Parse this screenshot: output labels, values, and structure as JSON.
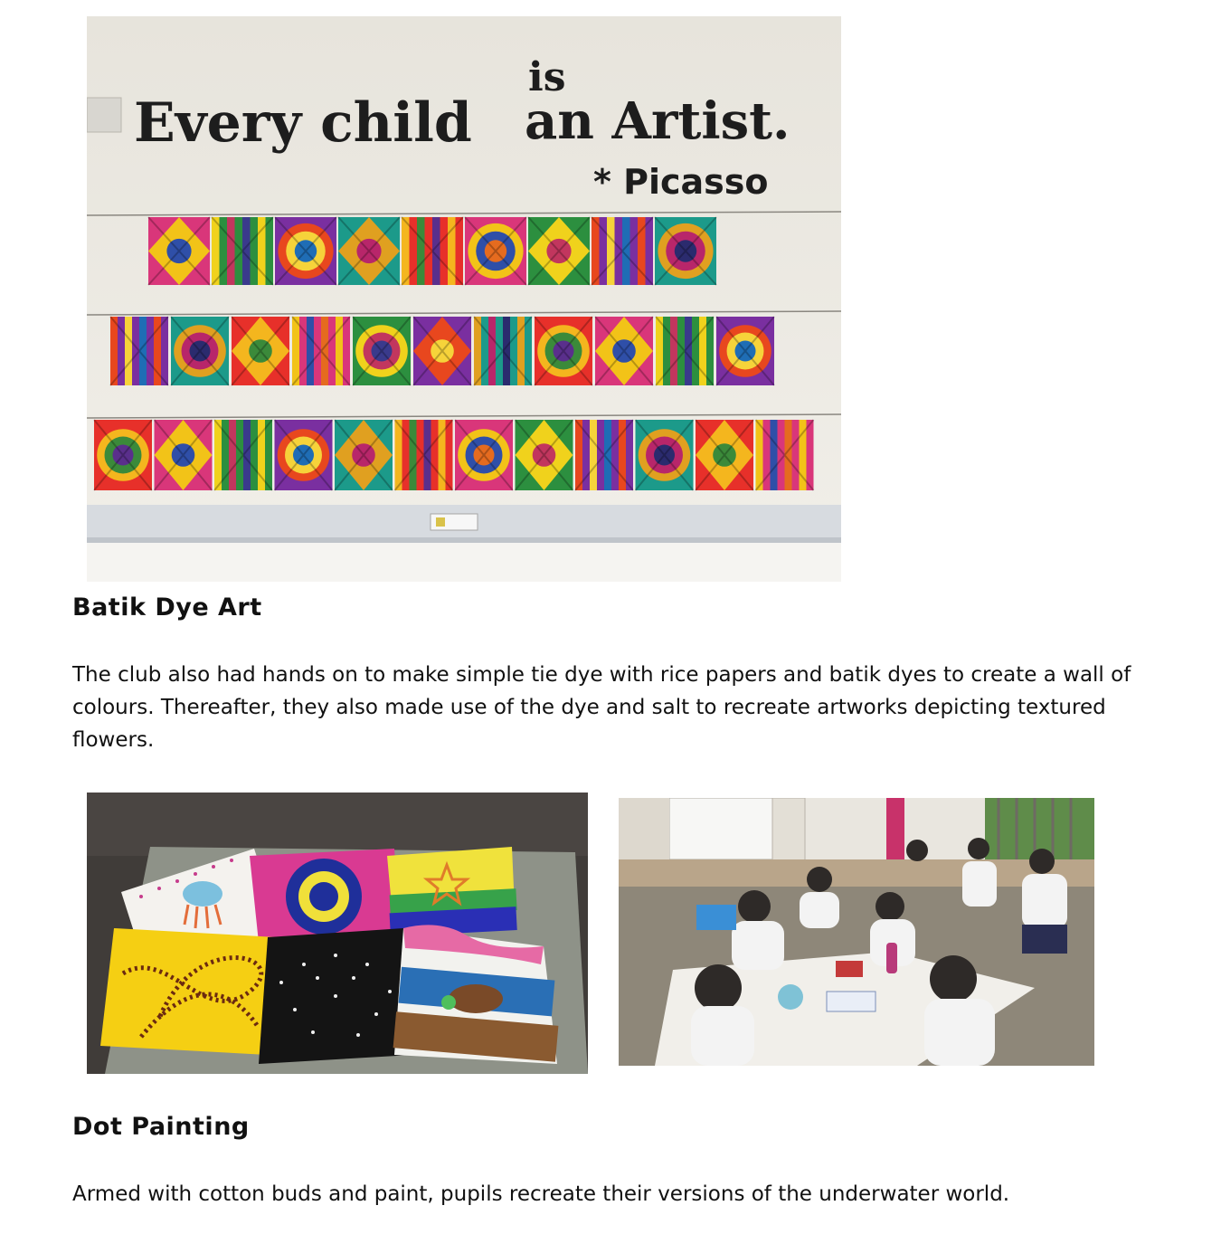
{
  "photos": {
    "wall": {
      "quote_line_left": "Every child",
      "quote_is": "is",
      "quote_line_right": "an Artist.",
      "quote_author": "* Picasso",
      "dyes_row1": 9,
      "dyes_row2": 11,
      "dyes_row3": 12
    },
    "dot_paintings": {},
    "classroom": {}
  },
  "sections": {
    "batik": {
      "heading": "Batik Dye Art",
      "paragraph": "The club also had hands on to make simple tie dye with rice papers and batik dyes to create a wall of colours. Thereafter, they also made use of the dye and salt to recreate artworks depicting textured flowers."
    },
    "dot": {
      "heading": "Dot Painting",
      "paragraph": "Armed with cotton buds and paint, pupils recreate their versions of the underwater world."
    }
  }
}
